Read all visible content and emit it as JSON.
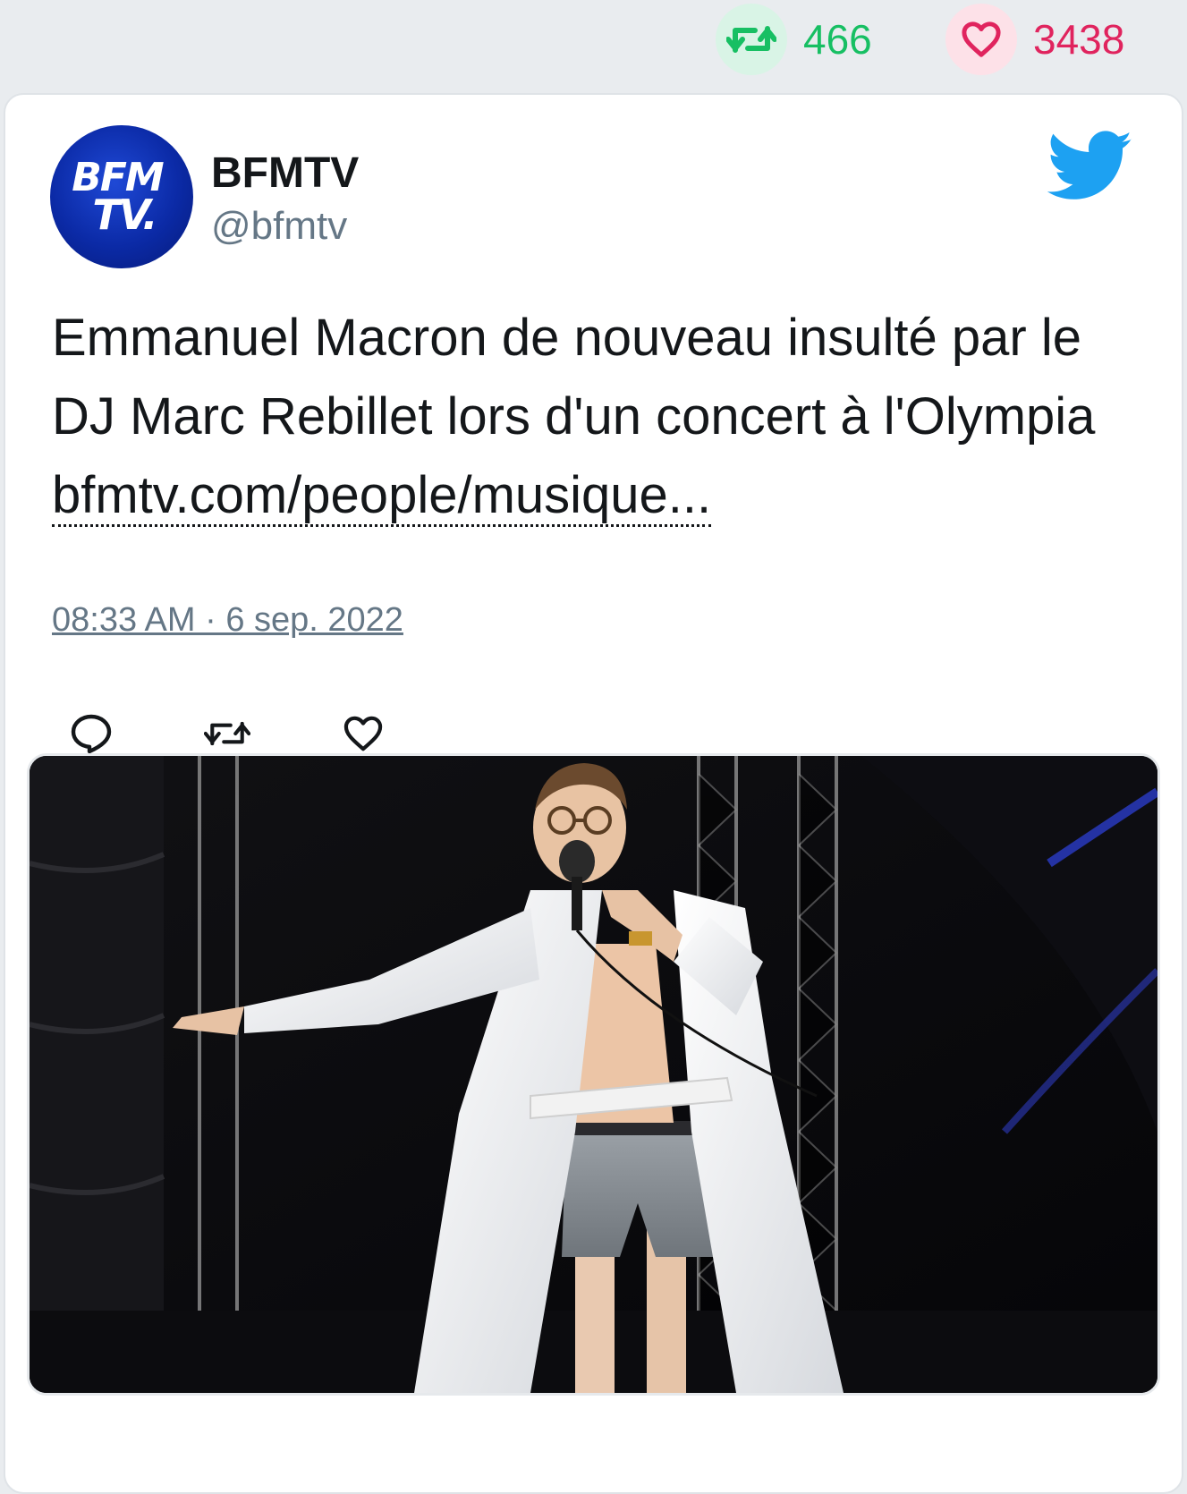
{
  "stats": {
    "retweets": "466",
    "likes": "3438",
    "retweet_icon": "retweet-icon",
    "like_icon": "heart-icon"
  },
  "author": {
    "name": "BFMTV",
    "handle": "@bfmtv",
    "avatar_line1": "BFM",
    "avatar_line2": "TV."
  },
  "tweet": {
    "text": "Emmanuel Macron de nouveau insulté par le DJ Marc Rebillet lors d'un concert à l'Olympia ",
    "link_text": "bfmtv.com/people/musique...",
    "timestamp": "08:33 AM · 6 sep. 2022"
  },
  "actions": {
    "reply_icon": "reply-icon",
    "retweet_icon": "retweet-icon",
    "like_icon": "heart-icon"
  },
  "colors": {
    "retweet": "#17bf63",
    "like": "#e0245e",
    "twitter_blue": "#1da1f2",
    "muted": "#657786"
  }
}
